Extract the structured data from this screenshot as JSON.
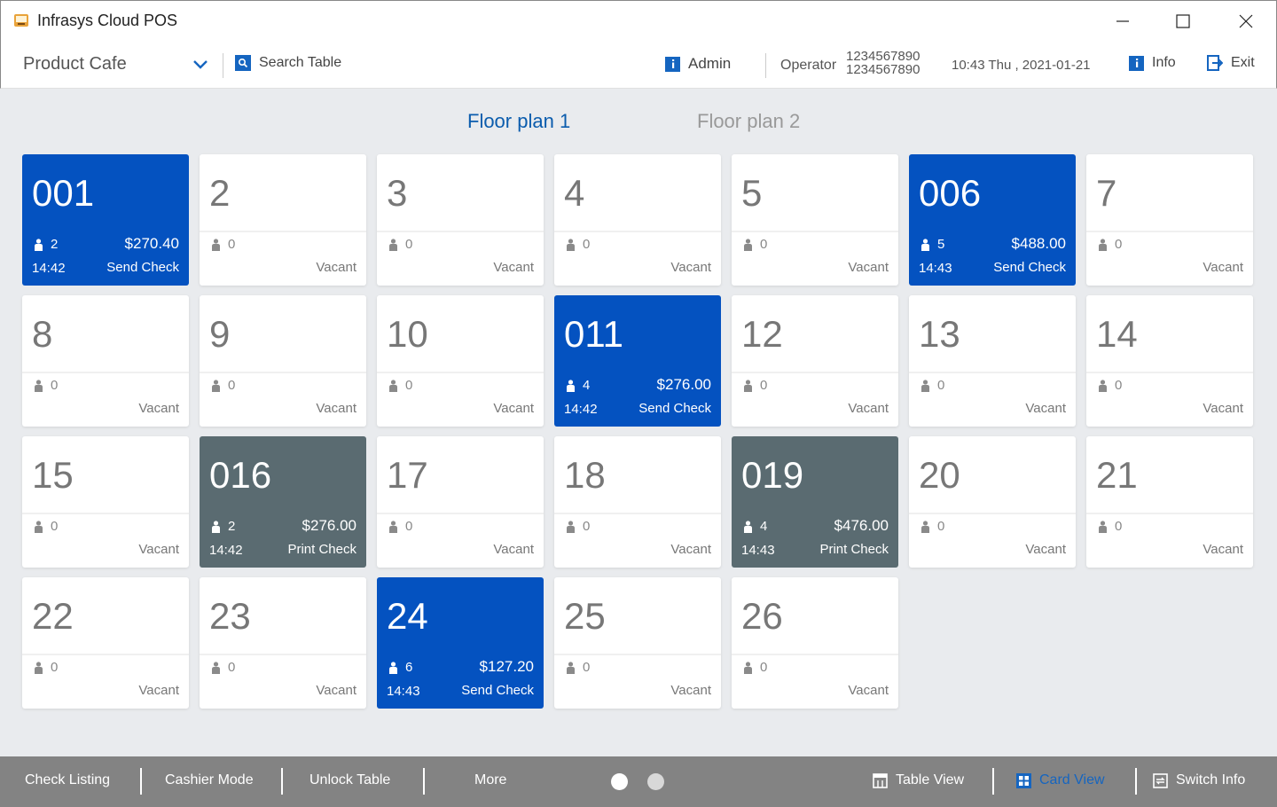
{
  "window": {
    "title": "Infrasys Cloud POS"
  },
  "header": {
    "outlet_name": "Product Cafe",
    "search_label": "Search Table",
    "user_label": "Admin",
    "operator_label": "Operator",
    "operator_ids": [
      "1234567890",
      "1234567890"
    ],
    "datetime": "10:43 Thu , 2021-01-21",
    "info_label": "Info",
    "exit_label": "Exit"
  },
  "floor_tabs": [
    {
      "label": "Floor plan 1",
      "active": true
    },
    {
      "label": "Floor plan 2",
      "active": false
    }
  ],
  "tables": [
    {
      "number": "001",
      "pax": "2",
      "amount": "$270.40",
      "time": "14:42",
      "status": "Send Check",
      "state": "blue"
    },
    {
      "number": "2",
      "pax": "0",
      "status": "Vacant",
      "state": "vacant"
    },
    {
      "number": "3",
      "pax": "0",
      "status": "Vacant",
      "state": "vacant"
    },
    {
      "number": "4",
      "pax": "0",
      "status": "Vacant",
      "state": "vacant"
    },
    {
      "number": "5",
      "pax": "0",
      "status": "Vacant",
      "state": "vacant"
    },
    {
      "number": "006",
      "pax": "5",
      "amount": "$488.00",
      "time": "14:43",
      "status": "Send Check",
      "state": "blue"
    },
    {
      "number": "7",
      "pax": "0",
      "status": "Vacant",
      "state": "vacant"
    },
    {
      "number": "8",
      "pax": "0",
      "status": "Vacant",
      "state": "vacant"
    },
    {
      "number": "9",
      "pax": "0",
      "status": "Vacant",
      "state": "vacant"
    },
    {
      "number": "10",
      "pax": "0",
      "status": "Vacant",
      "state": "vacant"
    },
    {
      "number": "011",
      "pax": "4",
      "amount": "$276.00",
      "time": "14:42",
      "status": "Send Check",
      "state": "blue"
    },
    {
      "number": "12",
      "pax": "0",
      "status": "Vacant",
      "state": "vacant"
    },
    {
      "number": "13",
      "pax": "0",
      "status": "Vacant",
      "state": "vacant"
    },
    {
      "number": "14",
      "pax": "0",
      "status": "Vacant",
      "state": "vacant"
    },
    {
      "number": "15",
      "pax": "0",
      "status": "Vacant",
      "state": "vacant"
    },
    {
      "number": "016",
      "pax": "2",
      "amount": "$276.00",
      "time": "14:42",
      "status": "Print Check",
      "state": "gray"
    },
    {
      "number": "17",
      "pax": "0",
      "status": "Vacant",
      "state": "vacant"
    },
    {
      "number": "18",
      "pax": "0",
      "status": "Vacant",
      "state": "vacant"
    },
    {
      "number": "019",
      "pax": "4",
      "amount": "$476.00",
      "time": "14:43",
      "status": "Print Check",
      "state": "gray"
    },
    {
      "number": "20",
      "pax": "0",
      "status": "Vacant",
      "state": "vacant"
    },
    {
      "number": "21",
      "pax": "0",
      "status": "Vacant",
      "state": "vacant"
    },
    {
      "number": "22",
      "pax": "0",
      "status": "Vacant",
      "state": "vacant"
    },
    {
      "number": "23",
      "pax": "0",
      "status": "Vacant",
      "state": "vacant"
    },
    {
      "number": "24",
      "pax": "6",
      "amount": "$127.20",
      "time": "14:43",
      "status": "Send Check",
      "state": "blue"
    },
    {
      "number": "25",
      "pax": "0",
      "status": "Vacant",
      "state": "vacant"
    },
    {
      "number": "26",
      "pax": "0",
      "status": "Vacant",
      "state": "vacant"
    }
  ],
  "footer": {
    "check_listing": "Check Listing",
    "cashier_mode": "Cashier Mode",
    "unlock_table": "Unlock Table",
    "more": "More",
    "table_view": "Table View",
    "card_view": "Card View",
    "switch_info": "Switch Info",
    "active_view": "Card View",
    "page_dots": 2,
    "active_page": 1
  },
  "colors": {
    "accent_blue": "#0452c0",
    "printed_gray": "#5a6b71",
    "footer_gray": "#838383",
    "active_tab": "#0b5cad"
  },
  "icons": [
    "app-icon",
    "minimize-icon",
    "maximize-icon",
    "close-icon",
    "chevron-down-icon",
    "search-icon",
    "admin-icon",
    "info-icon",
    "exit-icon",
    "person-icon",
    "table-view-icon",
    "card-view-icon",
    "switch-info-icon"
  ]
}
